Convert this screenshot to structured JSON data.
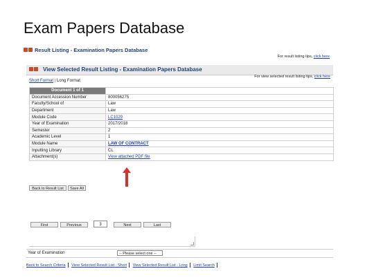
{
  "slide": {
    "title": "Exam Papers Database"
  },
  "outer_header": {
    "title": "Result Listing - Examination Papers Database",
    "tip_text": "For result listing tips,",
    "tip_link": "click here"
  },
  "inner_header": {
    "title": "View Selected Result Listing - Examination Papers Database",
    "tip_text": "For view selected result listing tips,",
    "tip_link": "click here"
  },
  "format_links": {
    "short": "Short Format",
    "separator": "|",
    "long": "Long Format"
  },
  "record": {
    "heading": "Document 1 of 1",
    "rows": [
      {
        "label": "Document Accession Number",
        "value": "800056275"
      },
      {
        "label": "Faculty/School of",
        "value": "Law"
      },
      {
        "label": "Department",
        "value": "Law"
      },
      {
        "label": "Module Code",
        "value": "LC1029"
      },
      {
        "label": "Year of Examination",
        "value": "2017/2018"
      },
      {
        "label": "Semester",
        "value": "2"
      },
      {
        "label": "Academic Level",
        "value": "1"
      },
      {
        "label": "Module Name",
        "value": "LAW OF CONTRACT"
      },
      {
        "label": "Inputting Library",
        "value": "CL"
      },
      {
        "label": "Attachment(s)",
        "value": "View attached PDF file"
      }
    ]
  },
  "actions": {
    "back": "Back to Result List",
    "save": "Save All"
  },
  "pager": {
    "first": "First",
    "previous": "Previous",
    "page": "3",
    "next": "Next",
    "last": "Last"
  },
  "year_filter": {
    "label": "Year of Examination",
    "selected": "-- Please select one --"
  },
  "footer": {
    "links": [
      "Back to Search Criteria",
      "View Selected Result List - Short",
      "View Selected Result List - Long",
      "Limit Search"
    ]
  },
  "colors": {
    "header_text": "#1f3f7a",
    "link": "#1a3fb0",
    "record_heading_bg": "#7a7a7a",
    "arrow": "#d9302b",
    "icon_bars": "#c84b2a"
  }
}
